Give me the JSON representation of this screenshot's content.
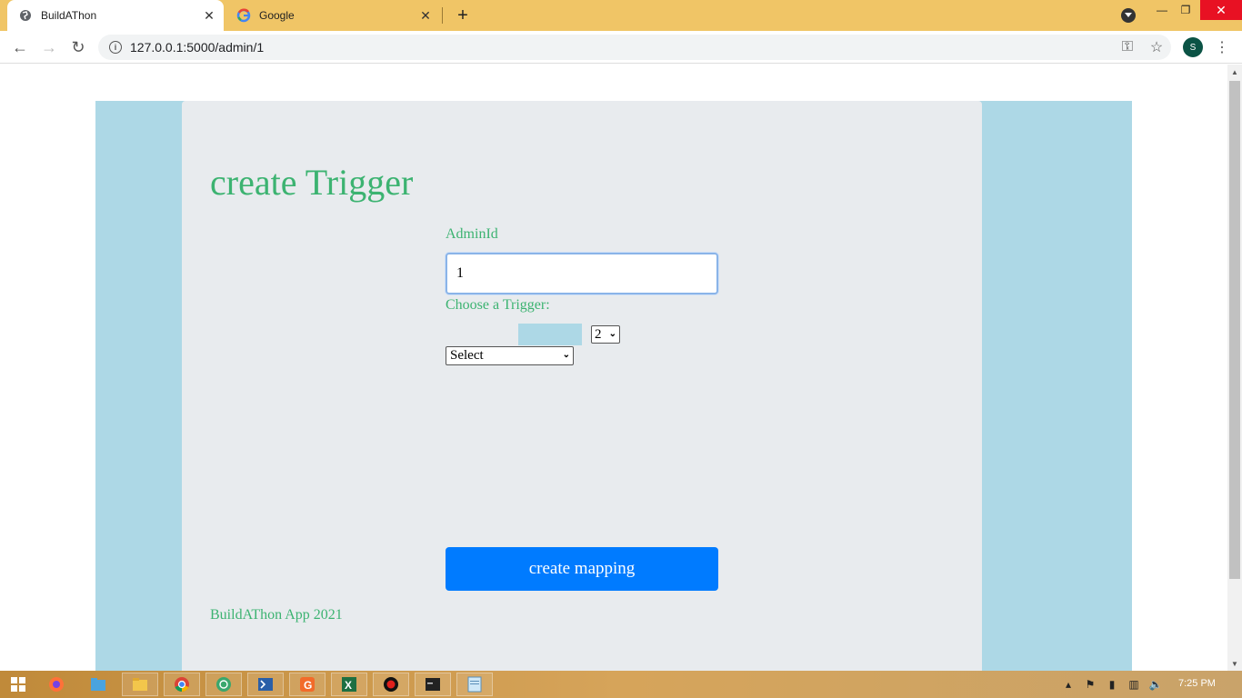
{
  "browser": {
    "tabs": [
      {
        "title": "BuildAThon",
        "active": true
      },
      {
        "title": "Google",
        "active": false
      }
    ],
    "new_tab": "+",
    "url": "127.0.0.1:5000/admin/1",
    "profile_initial": "S"
  },
  "page": {
    "heading": "create Trigger",
    "admin_label": "AdminId",
    "admin_value": "1",
    "trigger_label": "Choose a Trigger:",
    "count_select_value": "2",
    "trigger_select_value": "Select",
    "submit_label": "create mapping",
    "footer": "BuildAThon App 2021",
    "colors": {
      "accent_green": "#3cb371",
      "outer_blue": "#add8e6",
      "button_blue": "#007bff",
      "card_grey": "#e8ebee"
    }
  },
  "taskbar": {
    "apps": [
      "Firefox",
      "Files",
      "File Explorer",
      "Chrome",
      "Globe",
      "PowerShell",
      "App G",
      "Excel",
      "Recorder",
      "Terminal",
      "Notepad"
    ],
    "clock": "7:25 PM"
  }
}
